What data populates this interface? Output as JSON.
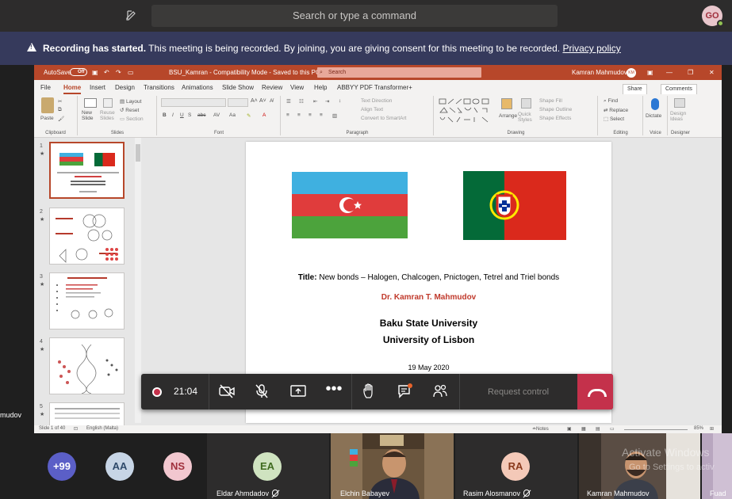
{
  "topbar": {
    "search_placeholder": "Search or type a command",
    "avatar_initials": "GO"
  },
  "recording_banner": {
    "title": "Recording has started.",
    "message": "This meeting is being recorded. By joining, you are giving consent for this meeting to be recorded.",
    "link": "Privacy policy"
  },
  "powerpoint": {
    "autosave": "AutoSave",
    "autosave_state": "Off",
    "doc_title": "BSU_Kamran  -  Compatibility Mode  -  Saved to this PC",
    "search": "Search",
    "user": "Kamran Mahmudov",
    "user_initials": "KM",
    "tabs": [
      "File",
      "Home",
      "Insert",
      "Design",
      "Transitions",
      "Animations",
      "Slide Show",
      "Review",
      "View",
      "Help",
      "ABBYY PDF Transformer+"
    ],
    "share": "Share",
    "comments": "Comments",
    "ribbon": {
      "paste": "Paste",
      "clipboard": "Clipboard",
      "new_slide": "New Slide",
      "reuse_slides": "Reuse Slides",
      "layout": "Layout",
      "reset": "Reset",
      "section": "Section",
      "slides": "Slides",
      "font": "Font",
      "text_direction": "Text Direction",
      "align_text": "Align Text",
      "convert_smartart": "Convert to SmartArt",
      "paragraph": "Paragraph",
      "arrange": "Arrange",
      "quick_styles": "Quick Styles",
      "shape_fill": "Shape Fill",
      "shape_outline": "Shape Outline",
      "shape_effects": "Shape Effects",
      "drawing": "Drawing",
      "find": "Find",
      "replace": "Replace",
      "select": "Select",
      "editing": "Editing",
      "dictate": "Dictate",
      "voice": "Voice",
      "design_ideas": "Design Ideas",
      "designer": "Designer"
    },
    "thumbnails": [
      "1",
      "2",
      "3",
      "4",
      "5"
    ],
    "slide": {
      "title_label": "Title:",
      "title_text": "New bonds – Halogen, Chalcogen, Pnictogen, Tetrel and Triel bonds",
      "author": "Dr. Kamran T. Mahmudov",
      "uni1": "Baku State University",
      "uni2": "University of Lisbon",
      "date": "19 May 2020"
    },
    "status": {
      "slide_count": "Slide 1 of 40",
      "language": "English (Malta)",
      "notes": "Notes",
      "zoom": "85%"
    }
  },
  "callbar": {
    "timer": "21:04",
    "request_control": "Request control"
  },
  "side_name": "mudov",
  "participants": [
    {
      "initials": "+99",
      "color": "#5b5fc7",
      "text": "#ffffff"
    },
    {
      "initials": "AA",
      "color": "#c7d5e6",
      "text": "#2f4a6b"
    },
    {
      "initials": "NS",
      "color": "#f2c7cf",
      "text": "#a0303d"
    },
    {
      "initials": "EA",
      "color": "#cfe3c0",
      "text": "#3f6b1f",
      "name": "Eldar Ahmdadov"
    },
    {
      "name": "Elchin Babayev"
    },
    {
      "initials": "RA",
      "color": "#f4c9b8",
      "text": "#8a3a1c",
      "name": "Rasim Alosmanov"
    },
    {
      "name": "Kamran Mahmudov"
    },
    {
      "name": "Fuad"
    }
  ],
  "watermark": {
    "line1": "Activate Windows",
    "line2": "Go to Settings to activ"
  }
}
